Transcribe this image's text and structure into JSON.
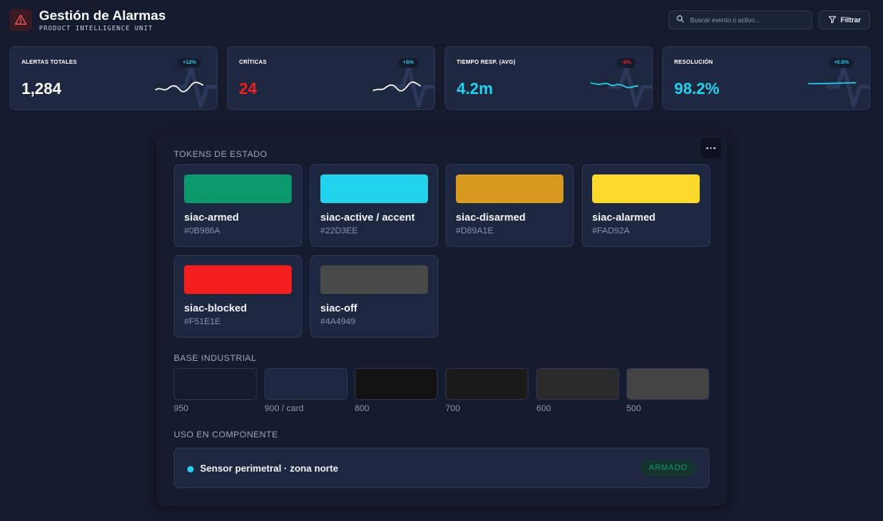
{
  "header": {
    "title": "Gestión de Alarmas",
    "subtitle": "PRODUCT INTELLIGENCE UNIT",
    "logo_icon": "alert-triangle-icon",
    "search_placeholder": "Buscar evento o activo...",
    "filter_label": "Filtrar"
  },
  "kpis": [
    {
      "label": "ALERTAS TOTALES",
      "value": "1,284",
      "badge": "+12%",
      "value_color": "#FFFFFF",
      "badge_color": "#22D3EE",
      "spark_color": "#FFFFFF"
    },
    {
      "label": "CRÍTICAS",
      "value": "24",
      "badge": "+5%",
      "value_color": "#F51E1E",
      "badge_color": "#22D3EE",
      "spark_color": "#FFFFFF"
    },
    {
      "label": "TIEMPO RESP. (AVG)",
      "value": "4.2m",
      "badge": "-8%",
      "value_color": "#22D3EE",
      "badge_color": "#F51E1E",
      "spark_color": "#22D3EE"
    },
    {
      "label": "RESOLUCIÓN",
      "value": "98.2%",
      "badge": "+0.5%",
      "value_color": "#22D3EE",
      "badge_color": "#22D3EE",
      "spark_color": "#22D3EE"
    }
  ],
  "tokens_section": {
    "title": "TOKENS DE ESTADO",
    "items": [
      {
        "name": "siac-armed",
        "hex": "#0B986A",
        "color": "#0B986A"
      },
      {
        "name": "siac-active / accent",
        "hex": "#22D3EE",
        "color": "#22D3EE"
      },
      {
        "name": "siac-disarmed",
        "hex": "#D89A1E",
        "color": "#D89A1E"
      },
      {
        "name": "siac-alarmed",
        "hex": "#FAD92A",
        "color": "#FAD92A"
      },
      {
        "name": "siac-blocked",
        "hex": "#F51E1E",
        "color": "#F51E1E"
      },
      {
        "name": "siac-off",
        "hex": "#4A4949",
        "color": "#4A4949"
      }
    ]
  },
  "base_section": {
    "title": "BASE INDUSTRIAL",
    "items": [
      {
        "label": "950",
        "color": "#151B2E"
      },
      {
        "label": "900 / card",
        "color": "#1E2740"
      },
      {
        "label": "800",
        "color": "#121212"
      },
      {
        "label": "700",
        "color": "#1A1A1A"
      },
      {
        "label": "600",
        "color": "#2A2A2A"
      },
      {
        "label": "500",
        "color": "#444444"
      }
    ]
  },
  "usage_section": {
    "title": "USO EN COMPONENTE",
    "text": "Sensor perimetral · zona norte",
    "badge": "ARMADO",
    "dot_color": "#22D3EE",
    "badge_color": "#0B986A"
  },
  "icons": {
    "search": "search-icon",
    "filter": "filter-icon",
    "more": "more-horizontal-icon",
    "kpi_background": "activity-icon"
  }
}
